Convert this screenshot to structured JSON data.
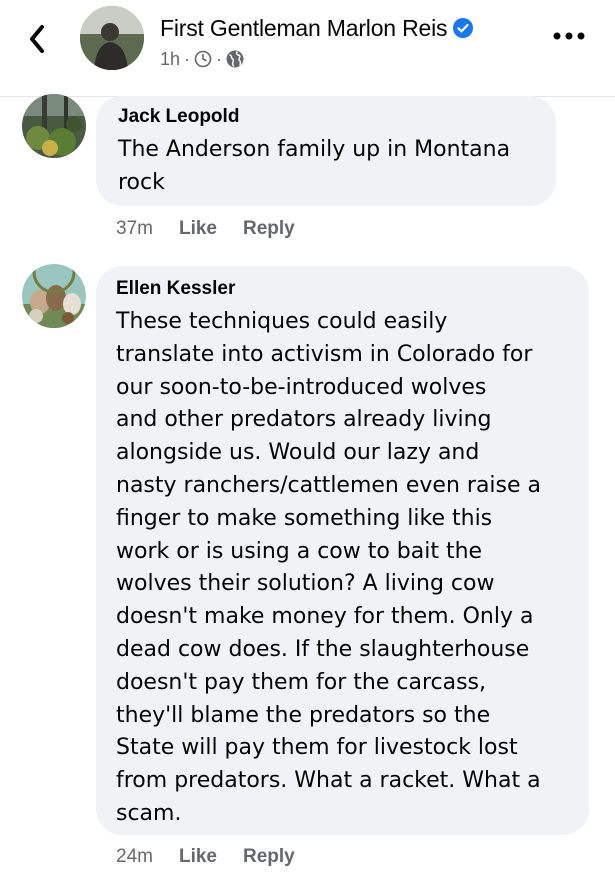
{
  "header": {
    "name": "First Gentleman Marlon Reis",
    "time": "1h",
    "separator": "·",
    "icons": [
      "back-chevron-icon",
      "verified-badge-icon",
      "clock-icon",
      "globe-icon",
      "more-horizontal-icon"
    ],
    "accent_color": "#1877f2"
  },
  "comments": [
    {
      "author": "Jack Leopold",
      "lines": [
        "The Anderson family up in Montana",
        "rock"
      ],
      "time": "37m",
      "like_label": "Like",
      "reply_label": "Reply"
    },
    {
      "author": "Ellen Kessler",
      "lines": [
        "These techniques could easily",
        "translate into activism in Colorado for",
        "our soon-to-be-introduced wolves",
        "and other predators already living",
        "alongside us. Would our lazy and",
        "nasty ranchers/cattlemen even raise a",
        "finger to make something like this",
        "work or is using a cow to bait the",
        "wolves their solution? A living cow",
        "doesn't make money for them. Only a",
        "dead cow does. If the slaughterhouse",
        "doesn't pay them for the carcass,",
        "they'll blame the predators so the",
        "State will pay them for livestock lost",
        "from predators. What a racket. What a",
        "scam."
      ],
      "time": "24m",
      "like_label": "Like",
      "reply_label": "Reply"
    }
  ],
  "colors": {
    "bubble_background": "#f0f2f5",
    "secondary_text": "#65676b",
    "primary_text": "#050505"
  }
}
